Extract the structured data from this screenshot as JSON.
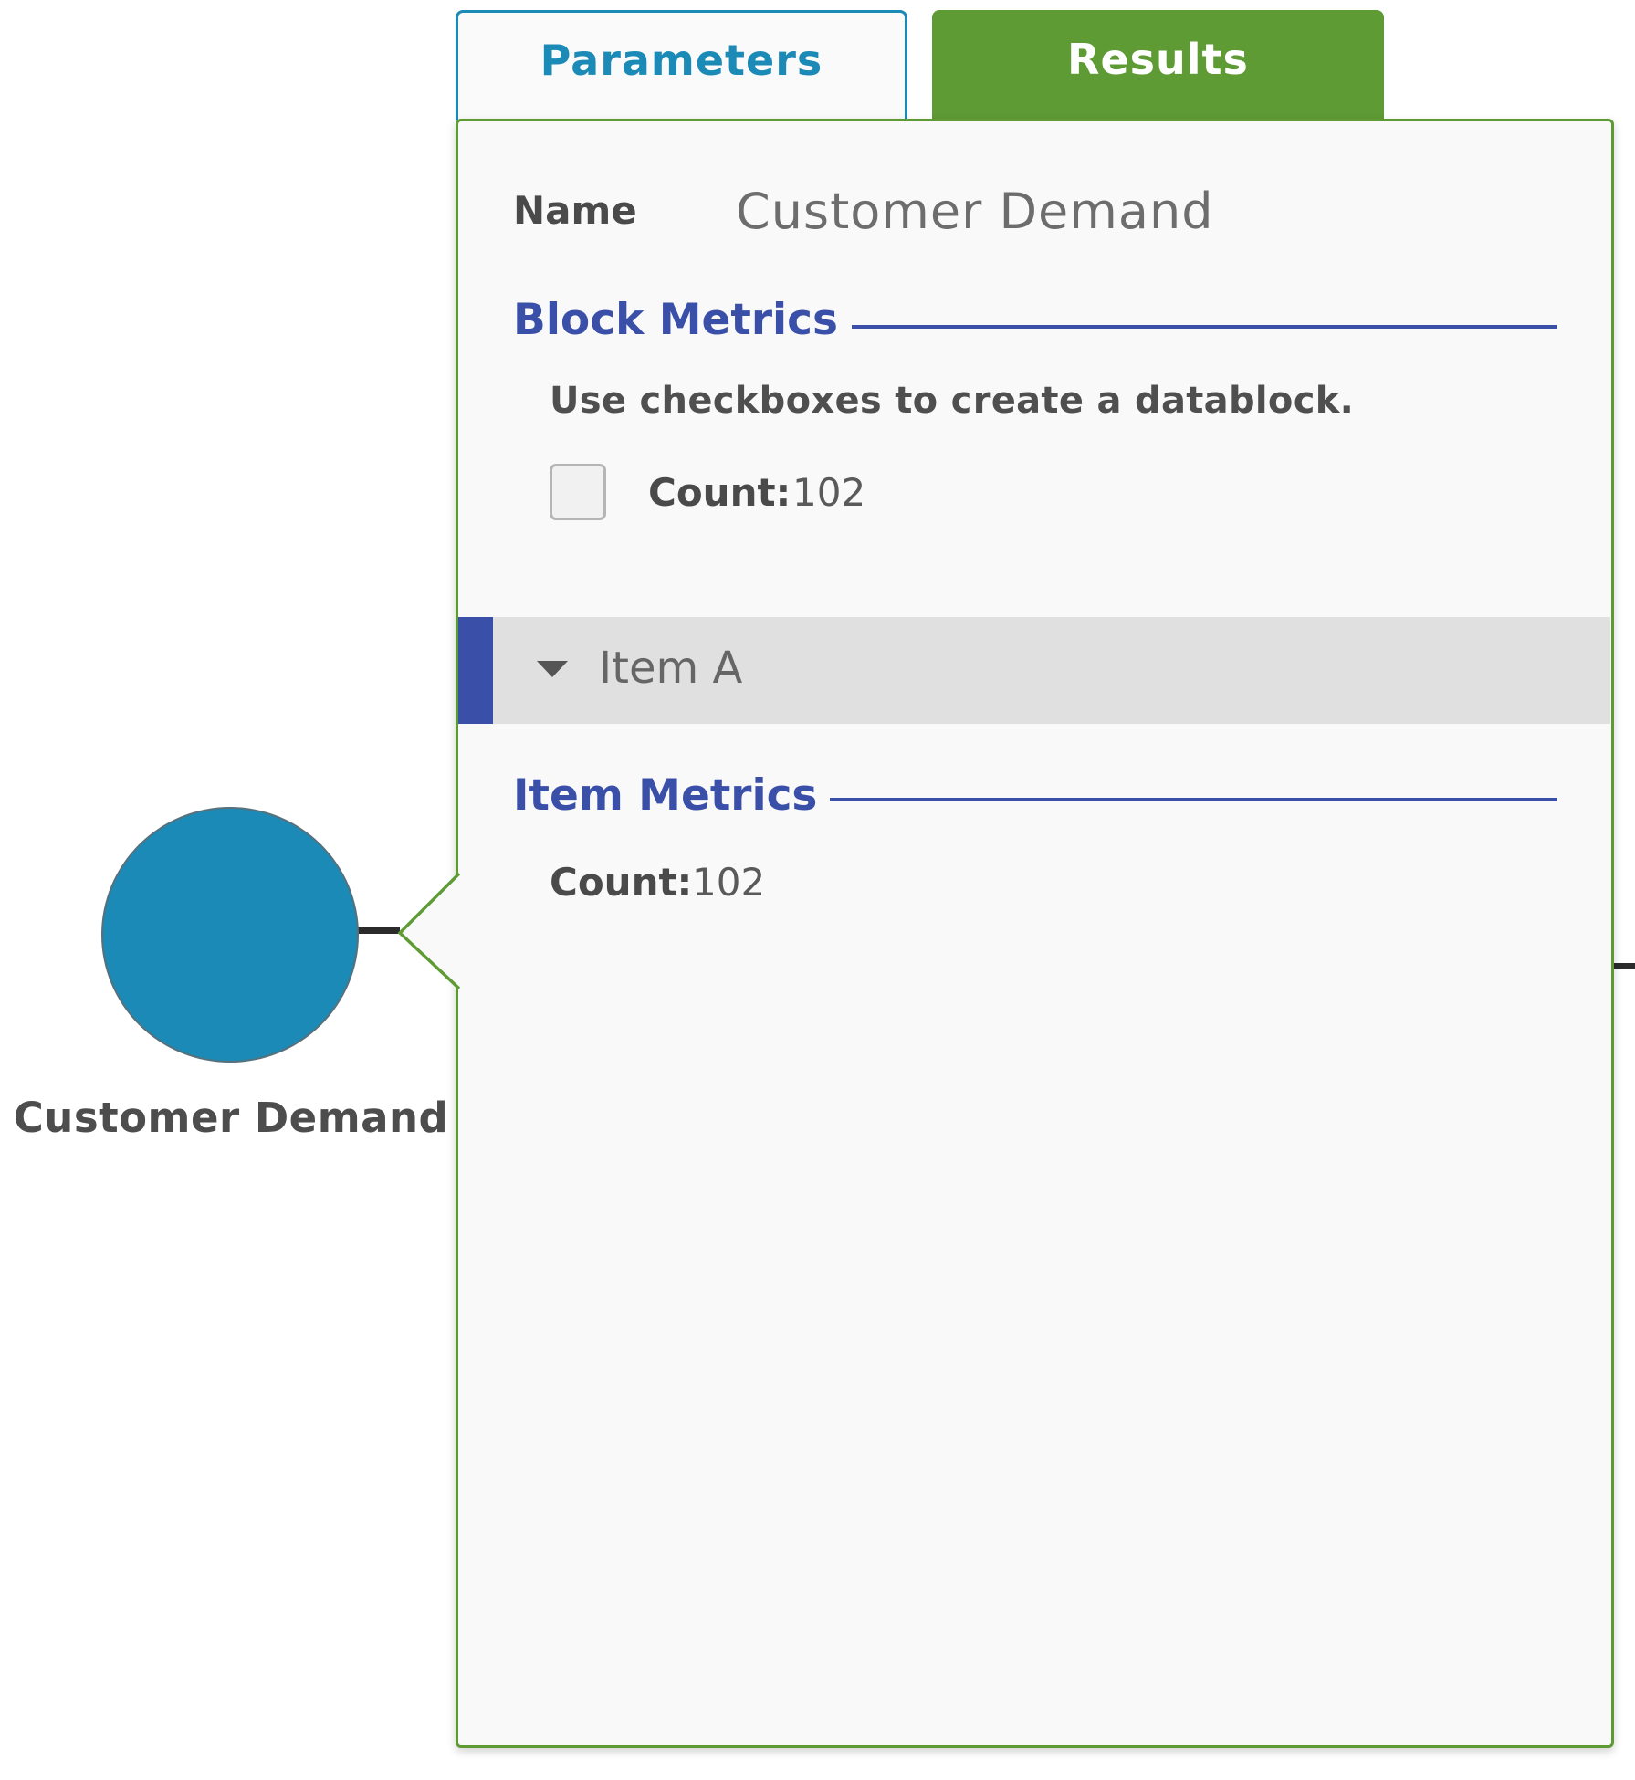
{
  "canvas": {
    "block_label": "Customer Demand",
    "block_color": "#1b8ab6",
    "block_shape": "circle"
  },
  "tabs": [
    {
      "label": "Parameters",
      "active": false,
      "color": "#1b8ab6"
    },
    {
      "label": "Results",
      "active": true,
      "color": "#5e9b35"
    }
  ],
  "panel": {
    "border_color": "#5e9b35",
    "name": {
      "label": "Name",
      "value": "Customer Demand"
    },
    "block_metrics": {
      "title": "Block Metrics",
      "help_text": "Use checkboxes to create a datablock.",
      "metrics": [
        {
          "label": "Count:",
          "value": "102",
          "checked": false
        }
      ]
    },
    "item": {
      "label": "Item A",
      "expanded": true,
      "accent_color": "#3a4fa8"
    },
    "item_metrics": {
      "title": "Item Metrics",
      "metrics": [
        {
          "label": "Count:",
          "value": "102"
        }
      ]
    }
  }
}
